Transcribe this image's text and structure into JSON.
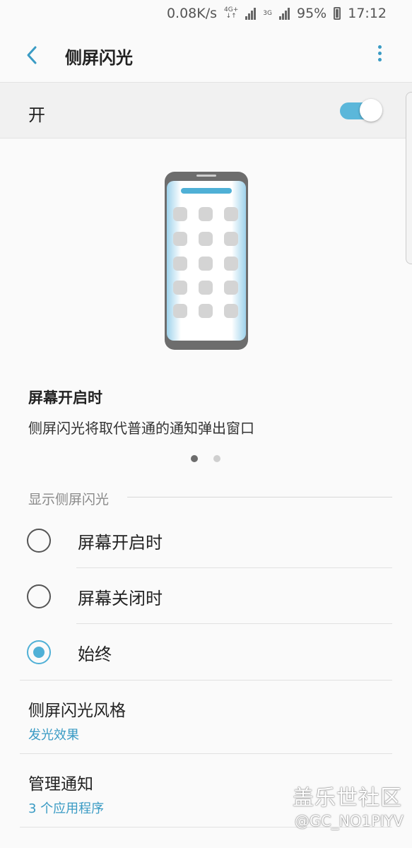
{
  "status_bar": {
    "speed": "0.08K/s",
    "net1": "4G+",
    "net2": "3G",
    "battery": "95%",
    "time": "17:12"
  },
  "app_bar": {
    "title": "侧屏闪光"
  },
  "master_switch": {
    "label": "开",
    "enabled": true
  },
  "illustration": {
    "title": "屏幕开启时",
    "description": "侧屏闪光将取代普通的通知弹出窗口",
    "page_count": 2,
    "current_page": 1
  },
  "display_section": {
    "header": "显示侧屏闪光",
    "options": [
      {
        "label": "屏幕开启时",
        "checked": false
      },
      {
        "label": "屏幕关闭时",
        "checked": false
      },
      {
        "label": "始终",
        "checked": true
      }
    ]
  },
  "style_item": {
    "title": "侧屏闪光风格",
    "value": "发光效果"
  },
  "manage_item": {
    "title": "管理通知",
    "value": "3 个应用程序"
  },
  "watermark": {
    "site": "盖乐世社区",
    "user": "@GC_NO1PIYV"
  },
  "colors": {
    "accent": "#4fb0d6",
    "link": "#3a9bc4"
  }
}
